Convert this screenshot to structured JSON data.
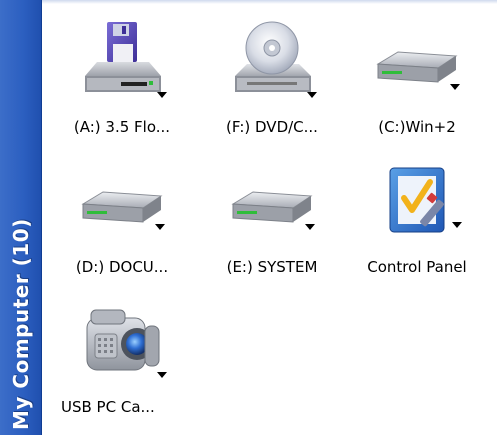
{
  "sidebar": {
    "title": "My Computer (10)"
  },
  "items": [
    {
      "label": "(A:) 3.5 Flo...",
      "icon": "floppy-drive-icon"
    },
    {
      "label": "(F:) DVD/C...",
      "icon": "cd-drive-icon"
    },
    {
      "label": "(C:)Win+2",
      "icon": "hard-drive-icon"
    },
    {
      "label": "(D:) DOCU...",
      "icon": "hard-drive-icon"
    },
    {
      "label": "(E:) SYSTEM",
      "icon": "hard-drive-icon"
    },
    {
      "label": "Control Panel",
      "icon": "control-panel-icon"
    },
    {
      "label": "USB PC Ca...",
      "icon": "camera-icon"
    }
  ]
}
